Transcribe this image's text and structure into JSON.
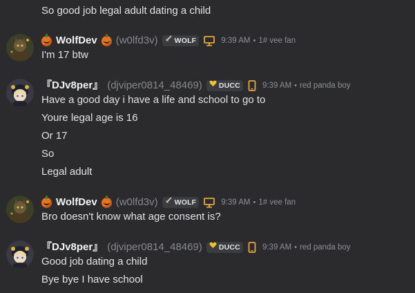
{
  "messages_top": {
    "line_0": "So good job legal adult dating a child"
  },
  "msg1": {
    "username": "WolfDev",
    "handle": "(w0lfd3v)",
    "tag": "WOLF",
    "tag_icon": "sword-icon",
    "device_icon": "desktop-icon",
    "time": "9:39 AM",
    "status": "1# vee fan",
    "lines": [
      "I'm 17 btw"
    ]
  },
  "msg2": {
    "username": "『DJv8per』",
    "handle": "(djviper0814_48469)",
    "tag": "DUCC",
    "tag_icon": "heart-icon",
    "device_icon": "mobile-icon",
    "time": "9:39 AM",
    "status": "red panda boy",
    "lines": [
      "Have a good day i have a life and school to go to",
      "Youre legal age is 16",
      "Or 17",
      "So",
      "Legal adult"
    ]
  },
  "msg3": {
    "username": "WolfDev",
    "handle": "(w0lfd3v)",
    "tag": "WOLF",
    "tag_icon": "sword-icon",
    "device_icon": "desktop-icon",
    "time": "9:39 AM",
    "status": "1# vee fan",
    "lines": [
      "Bro doesn't know what age consent is?"
    ]
  },
  "msg4": {
    "username": "『DJv8per』",
    "handle": "(djviper0814_48469)",
    "tag": "DUCC",
    "tag_icon": "heart-icon",
    "device_icon": "mobile-icon",
    "time": "9:39 AM",
    "status": "red panda boy",
    "lines": [
      "Good job dating a child",
      "Bye bye I have school"
    ]
  },
  "colors": {
    "background": "#2b2b2e",
    "text": "#e3e4e6",
    "muted": "#87898c",
    "pumpkin": "#e8731a",
    "heart": "#f0c12c"
  }
}
